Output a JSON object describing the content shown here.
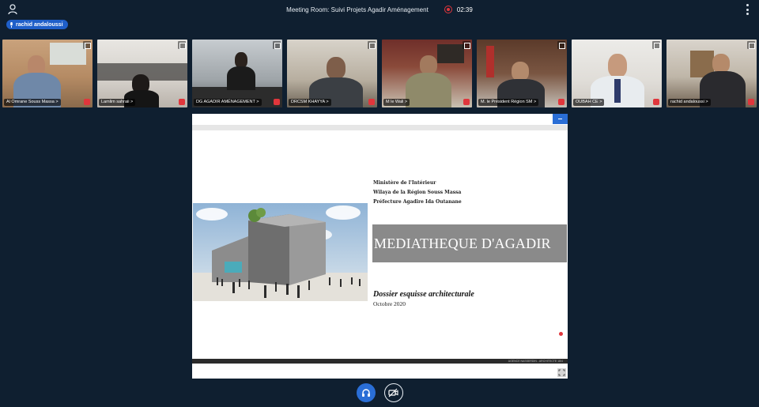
{
  "topbar": {
    "meeting_title": "Meeting Room: Suivi Projets Agadir Aménagement",
    "timer": "02:39"
  },
  "active_speaker": {
    "name": "rachid andaloussi"
  },
  "participants": [
    {
      "name": "Al Omrane Souss Massa  >"
    },
    {
      "name": "Lamlim sahraii  >"
    },
    {
      "name": "DG AGADIR AMÉNAGEMENT  >"
    },
    {
      "name": "DRCSM KHAYYA  >"
    },
    {
      "name": "M le Wali  >"
    },
    {
      "name": "M. le Président Région SM  >"
    },
    {
      "name": "OUBAH CE  >"
    },
    {
      "name": "rachid andaloussi  >"
    }
  ],
  "slide": {
    "org_lines": [
      "Ministère de l'Intérieur",
      "Wilaya de la Région Souss Massa",
      "Préfecture Agadire Ida Outanane"
    ],
    "title": "MEDIATHEQUE D'AGADIR",
    "subtitle": "Dossier esquisse architecturale",
    "date": "Octobre 2020",
    "footer": "AGENCE NASSERDIN - ARCHITECTE    18/4"
  },
  "colors": {
    "background": "#0f1f30",
    "accent_blue": "#2a6ed6",
    "record_red": "#e0363c",
    "title_bar": "#8a8a8a"
  },
  "icons": {
    "participants": "user-icon",
    "more": "kebab-menu-icon",
    "record": "record-icon",
    "audio": "headphones-icon",
    "video": "camera-off-icon"
  }
}
